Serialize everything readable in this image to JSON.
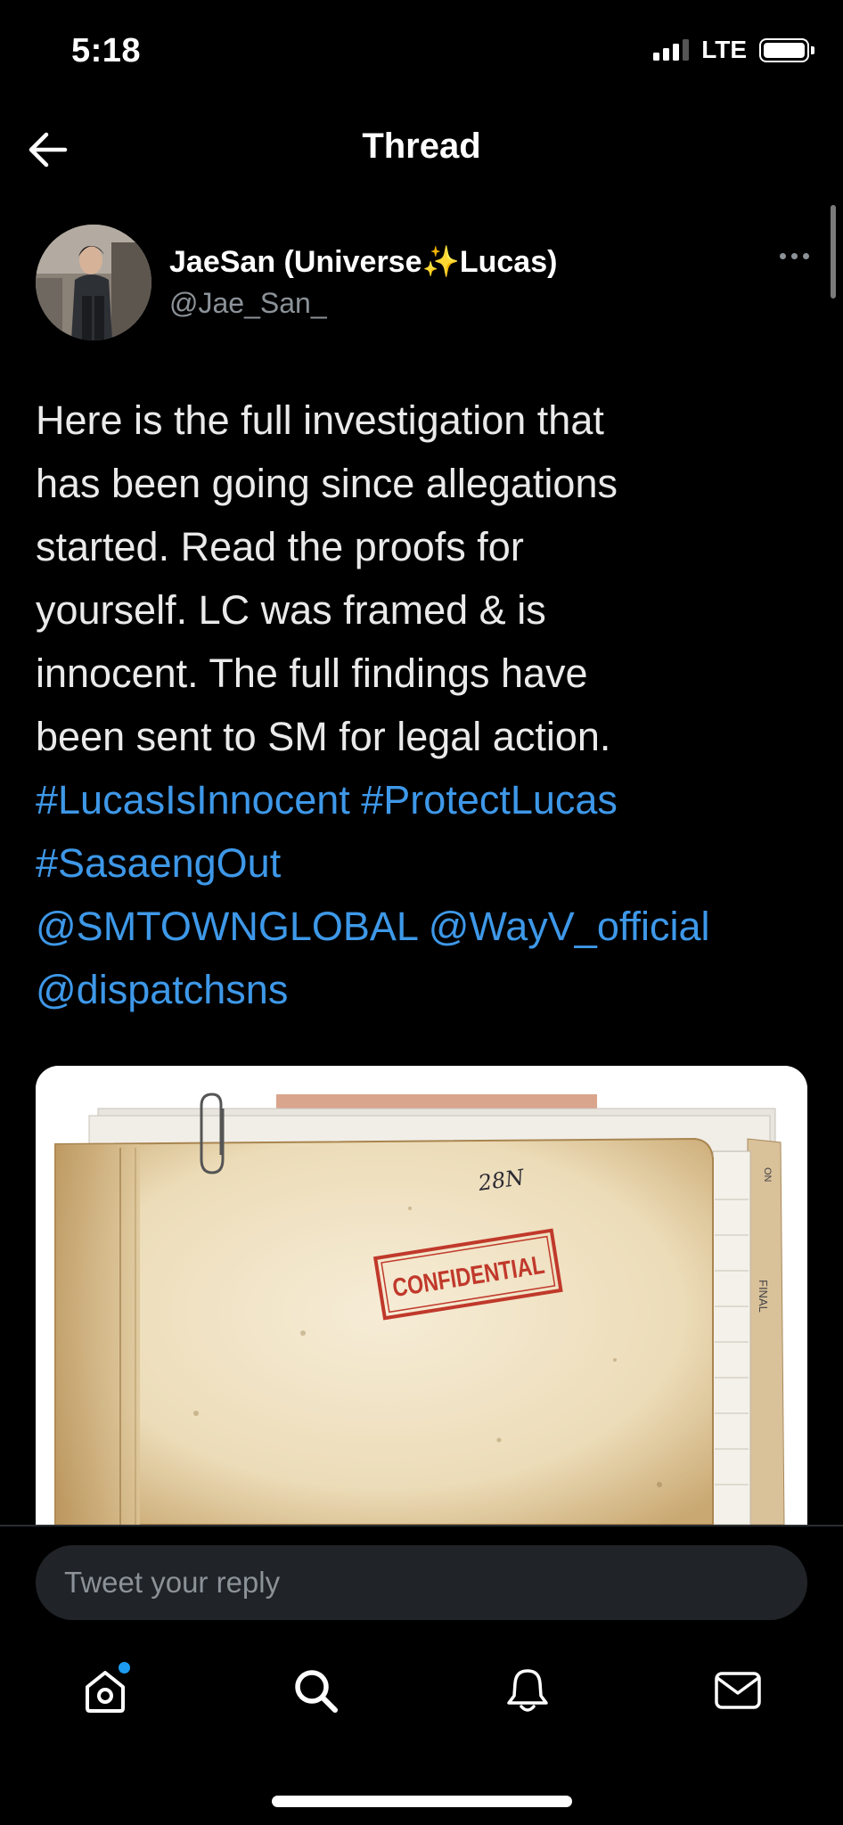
{
  "status_bar": {
    "time": "5:18",
    "network": "LTE"
  },
  "nav": {
    "title": "Thread",
    "back_icon": "arrow-left-icon"
  },
  "tweet": {
    "author_name": "JaeSan (Universe",
    "author_name_emoji": "✨",
    "author_name_end": "Lucas)",
    "handle": "@Jae_San_",
    "lines": [
      "Here is the full  investigation that",
      "has been going since allegations",
      "started. Read the proofs for",
      "yourself. LC was framed & is",
      "innocent. The full findings have",
      "been sent to SM for legal action."
    ],
    "hashtags": [
      "#LucasIsInnocent",
      "#ProtectLucas",
      "#SasaengOut"
    ],
    "mentions": [
      "@SMTOWNGLOBAL",
      "@WayV_official",
      "@dispatchsns"
    ],
    "media": {
      "folder_number": "28N",
      "stamp_text": "CONFIDENTIAL",
      "tab_text": "FINAL",
      "corner_text": "ON"
    }
  },
  "reply": {
    "placeholder": "Tweet your reply"
  },
  "tabbar": {
    "items": [
      {
        "name": "home",
        "icon": "home-icon",
        "has_badge": true
      },
      {
        "name": "search",
        "icon": "search-icon"
      },
      {
        "name": "notifications",
        "icon": "bell-icon"
      },
      {
        "name": "messages",
        "icon": "mail-icon"
      }
    ]
  },
  "colors": {
    "background": "#000000",
    "link": "#3e98e8",
    "muted": "#8b9298",
    "badge": "#1d9bf0",
    "input_bg": "#202327"
  }
}
